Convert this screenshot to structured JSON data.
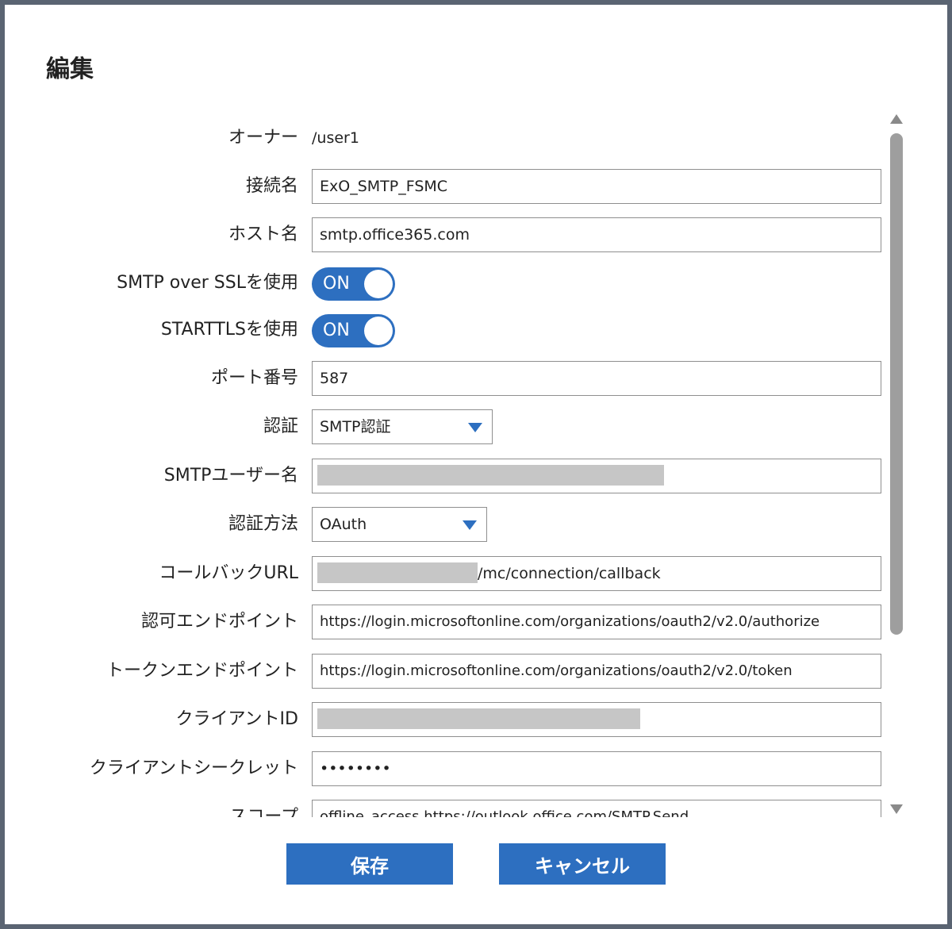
{
  "dialog": {
    "title": "編集"
  },
  "form": {
    "owner": {
      "label": "オーナー",
      "value": "/user1"
    },
    "connection_name": {
      "label": "接続名",
      "value": "ExO_SMTP_FSMC"
    },
    "host_name": {
      "label": "ホスト名",
      "value": "smtp.office365.com"
    },
    "smtp_over_ssl": {
      "label": "SMTP over SSLを使用",
      "state": "ON"
    },
    "starttls": {
      "label": "STARTTLSを使用",
      "state": "ON"
    },
    "port": {
      "label": "ポート番号",
      "value": "587"
    },
    "auth": {
      "label": "認証",
      "value": "SMTP認証"
    },
    "smtp_user": {
      "label": "SMTPユーザー名",
      "value": ""
    },
    "auth_method": {
      "label": "認証方法",
      "value": "OAuth"
    },
    "callback_url": {
      "label": "コールバックURL",
      "value_suffix": "/mc/connection/callback"
    },
    "auth_endpoint": {
      "label": "認可エンドポイント",
      "value": "https://login.microsoftonline.com/organizations/oauth2/v2.0/authorize"
    },
    "token_endpoint": {
      "label": "トークンエンドポイント",
      "value": "https://login.microsoftonline.com/organizations/oauth2/v2.0/token"
    },
    "client_id": {
      "label": "クライアントID",
      "value": ""
    },
    "client_secret": {
      "label": "クライアントシークレット",
      "value": "••••••••"
    },
    "scope": {
      "label": "スコープ",
      "value": "offline_access https://outlook.office.com/SMTP.Send"
    }
  },
  "buttons": {
    "save": "保存",
    "cancel": "キャンセル"
  },
  "colors": {
    "accent": "#2d6fc0",
    "redaction": "#c6c6c6"
  },
  "icons": {
    "dropdown": "chevron-down-icon",
    "scroll_up": "scroll-up-arrow-icon",
    "scroll_down": "scroll-down-arrow-icon"
  }
}
